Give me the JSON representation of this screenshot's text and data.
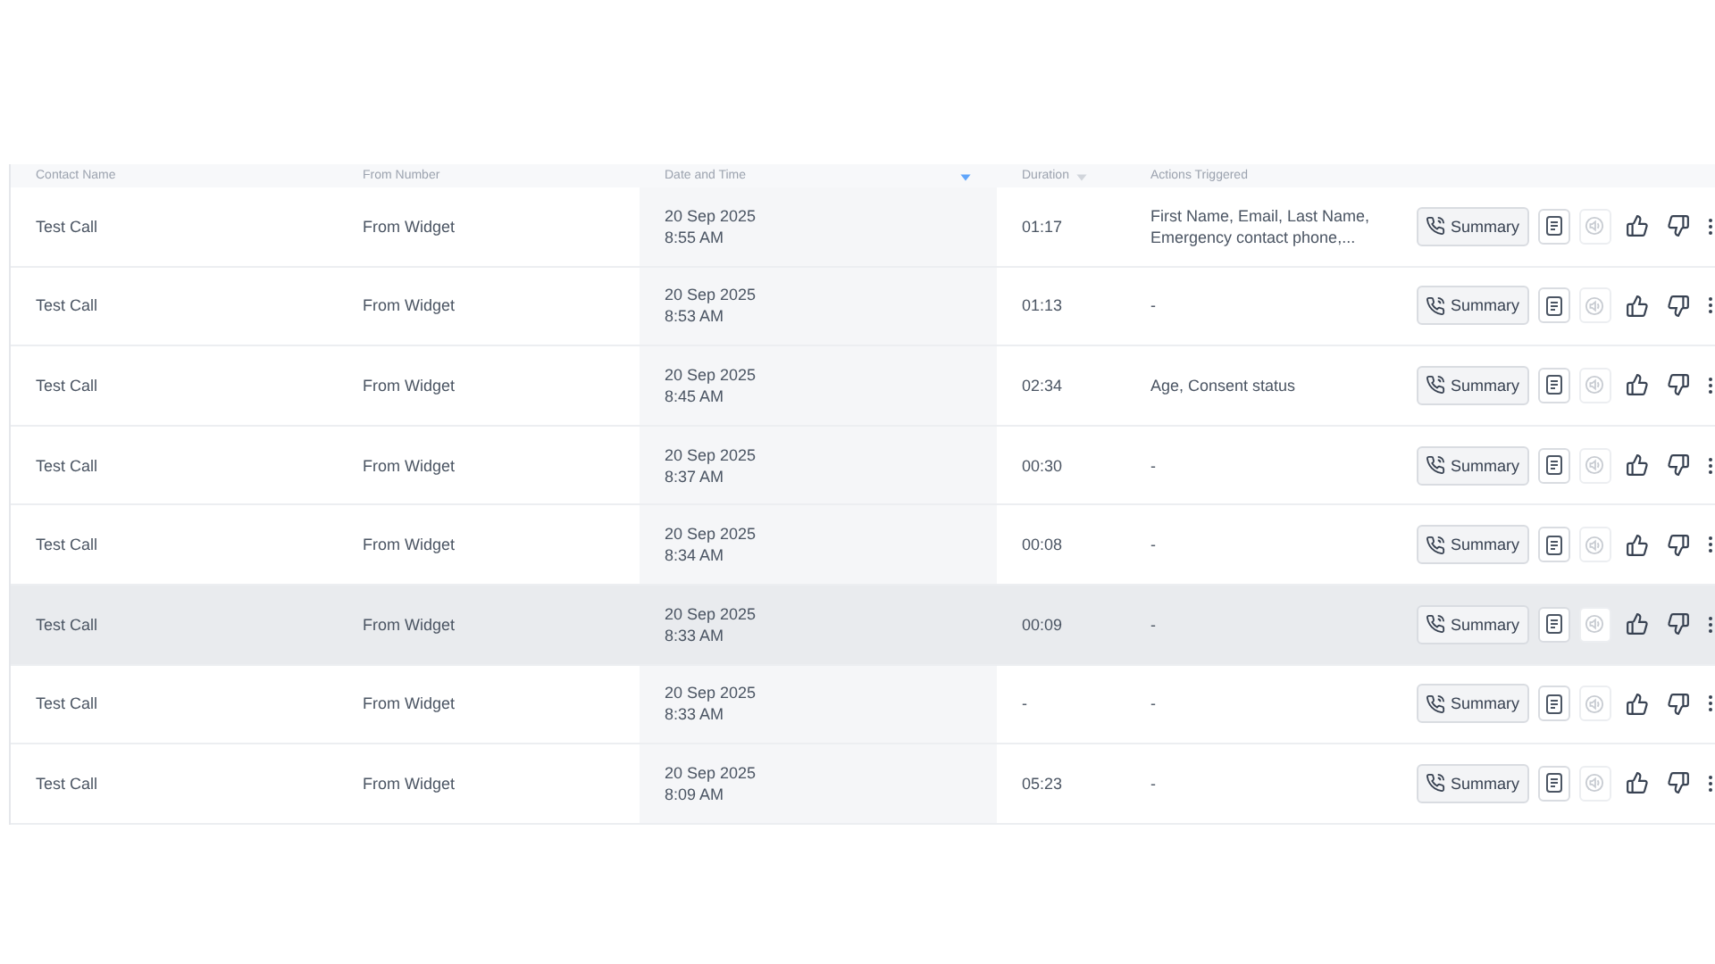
{
  "table": {
    "columns": [
      {
        "label": "Contact Name"
      },
      {
        "label": "From Number"
      },
      {
        "label": "Date and Time",
        "sorted": true
      },
      {
        "label": "Duration",
        "sorted": false
      },
      {
        "label": "Actions Triggered"
      }
    ],
    "rows": [
      {
        "contact": "Test Call",
        "from": "From Widget",
        "date": "20 Sep 2025",
        "time": "8:55 AM",
        "duration": "01:17",
        "actions": "First Name, Email, Last Name, Emergency contact phone,...",
        "summary": "Summary",
        "audio_enabled": false,
        "selected": false
      },
      {
        "contact": "Test Call",
        "from": "From Widget",
        "date": "20 Sep 2025",
        "time": "8:53 AM",
        "duration": "01:13",
        "actions": "-",
        "summary": "Summary",
        "audio_enabled": false,
        "selected": false
      },
      {
        "contact": "Test Call",
        "from": "From Widget",
        "date": "20 Sep 2025",
        "time": "8:45 AM",
        "duration": "02:34",
        "actions": "Age, Consent status",
        "summary": "Summary",
        "audio_enabled": false,
        "selected": false
      },
      {
        "contact": "Test Call",
        "from": "From Widget",
        "date": "20 Sep 2025",
        "time": "8:37 AM",
        "duration": "00:30",
        "actions": "-",
        "summary": "Summary",
        "audio_enabled": false,
        "selected": false
      },
      {
        "contact": "Test Call",
        "from": "From Widget",
        "date": "20 Sep 2025",
        "time": "8:34 AM",
        "duration": "00:08",
        "actions": "-",
        "summary": "Summary",
        "audio_enabled": false,
        "selected": false
      },
      {
        "contact": "Test Call",
        "from": "From Widget",
        "date": "20 Sep 2025",
        "time": "8:33 AM",
        "duration": "00:09",
        "actions": "-",
        "summary": "Summary",
        "audio_enabled": false,
        "selected": true
      },
      {
        "contact": "Test Call",
        "from": "From Widget",
        "date": "20 Sep 2025",
        "time": "8:33 AM",
        "duration": "-",
        "actions": "-",
        "summary": "Summary",
        "audio_enabled": false,
        "selected": false
      },
      {
        "contact": "Test Call",
        "from": "From Widget",
        "date": "20 Sep 2025",
        "time": "8:09 AM",
        "duration": "05:23",
        "actions": "-",
        "summary": "Summary",
        "audio_enabled": false,
        "selected": false
      }
    ]
  }
}
